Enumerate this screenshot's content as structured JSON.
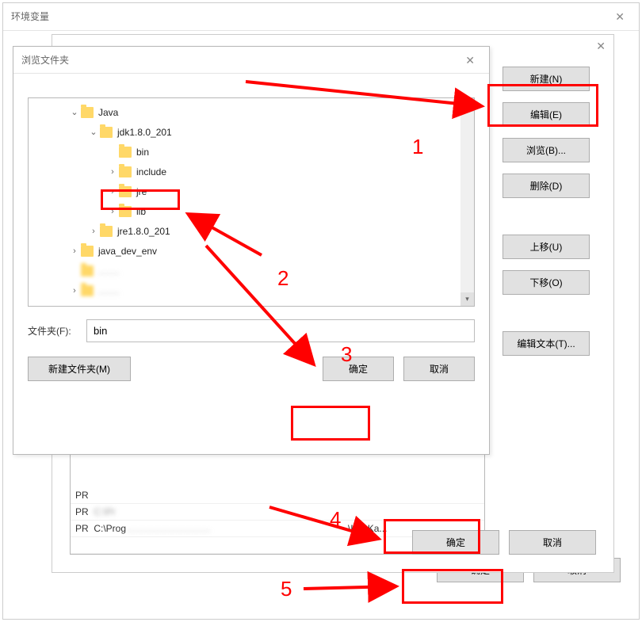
{
  "env_dialog": {
    "title": "环境变量",
    "ok": "确定",
    "cancel": "取消"
  },
  "edit_dialog": {
    "buttons": {
      "new": "新建(N)",
      "edit": "编辑(E)",
      "browse": "浏览(B)...",
      "delete": "删除(D)",
      "moveup": "上移(U)",
      "movedown": "下移(O)",
      "edittext": "编辑文本(T)..."
    },
    "path_rows": [
      {
        "prefix": "PR",
        "mid": "",
        "suffix": ""
      },
      {
        "prefix": "PR",
        "mid": "C:\\Pr",
        "suffix": ""
      },
      {
        "prefix": "PR",
        "mid": "C:\\Prog",
        "suffix": "\\KanKa..."
      },
      {
        "prefix": "PR",
        "mid": "",
        "suffix": ""
      }
    ],
    "ok": "确定",
    "cancel": "取消"
  },
  "browse_dialog": {
    "title": "浏览文件夹",
    "tree": [
      {
        "level": 0,
        "expander": "v",
        "label": "Java"
      },
      {
        "level": 1,
        "expander": "v",
        "label": "jdk1.8.0_201"
      },
      {
        "level": 2,
        "expander": "",
        "label": "bin"
      },
      {
        "level": 2,
        "expander": ">",
        "label": "include"
      },
      {
        "level": 2,
        "expander": ">",
        "label": "jre"
      },
      {
        "level": 2,
        "expander": ">",
        "label": "lib"
      },
      {
        "level": 1,
        "expander": ">",
        "label": "jre1.8.0_201"
      },
      {
        "level": 0,
        "expander": ">",
        "label": "java_dev_env"
      },
      {
        "level": 0,
        "expander": "",
        "label": ""
      },
      {
        "level": 0,
        "expander": ">",
        "label": ""
      }
    ],
    "folder_label": "文件夹(F):",
    "folder_value": "bin",
    "new_folder": "新建文件夹(M)",
    "ok": "确定",
    "cancel": "取消"
  },
  "annotations": {
    "n1": "1",
    "n2": "2",
    "n3": "3",
    "n4": "4",
    "n5": "5"
  }
}
